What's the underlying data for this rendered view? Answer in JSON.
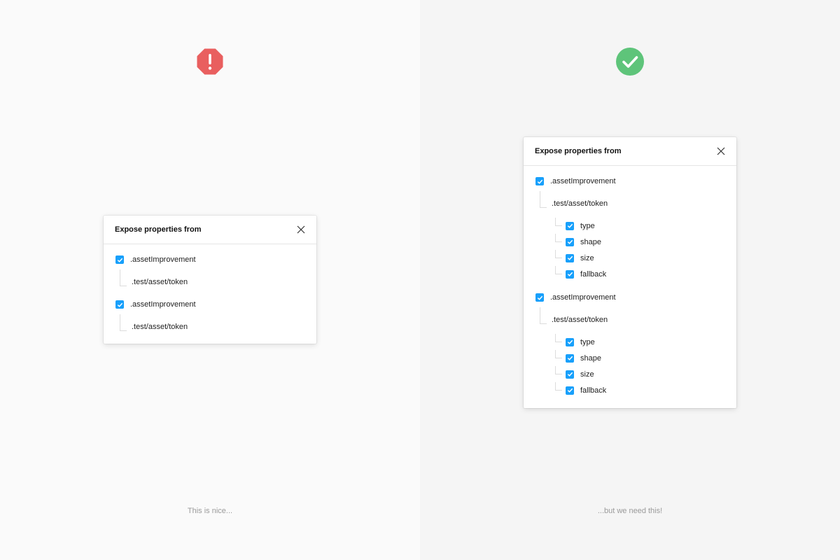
{
  "left": {
    "caption": "This is nice...",
    "icon": "alert-octagon-icon",
    "icon_color": "#e95f5f",
    "panel": {
      "title": "Expose properties from",
      "groups": [
        {
          "asset": ".assetImprovement",
          "path": ".test/asset/token"
        },
        {
          "asset": ".assetImprovement",
          "path": ".test/asset/token"
        }
      ]
    }
  },
  "right": {
    "caption": "...but we need this!",
    "icon": "check-circle-icon",
    "icon_color": "#5ec47a",
    "panel": {
      "title": "Expose properties from",
      "groups": [
        {
          "asset": ".assetImprovement",
          "path": ".test/asset/token",
          "properties": [
            "type",
            "shape",
            "size",
            "fallback"
          ]
        },
        {
          "asset": ".assetImprovement",
          "path": ".test/asset/token",
          "properties": [
            "type",
            "shape",
            "size",
            "fallback"
          ]
        }
      ]
    }
  },
  "colors": {
    "checkbox": "#18a0fb"
  }
}
